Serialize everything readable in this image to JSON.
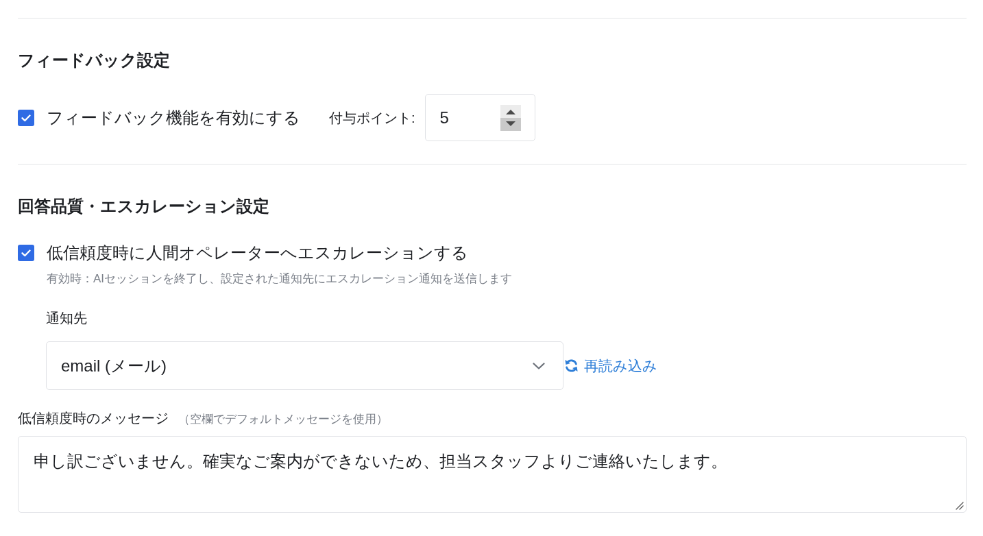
{
  "feedback_section": {
    "title": "フィードバック設定",
    "enable_checkbox": {
      "label": "フィードバック機能を有効にする",
      "checked": true
    },
    "points_field": {
      "label": "付与ポイント:",
      "value": "5"
    }
  },
  "escalation_section": {
    "title": "回答品質・エスカレーション設定",
    "escalate_checkbox": {
      "label": "低信頼度時に人間オペレーターへエスカレーションする",
      "checked": true,
      "help": "有効時：AIセッションを終了し、設定された通知先にエスカレーション通知を送信します"
    },
    "notify_target": {
      "label": "通知先",
      "value": "email (メール)",
      "reload_link": "再読み込み"
    },
    "low_confidence_message": {
      "label": "低信頼度時のメッセージ",
      "hint": "（空欄でデフォルトメッセージを使用）",
      "value": "申し訳ございません。確実なご案内ができないため、担当スタッフよりご連絡いたします。"
    }
  }
}
